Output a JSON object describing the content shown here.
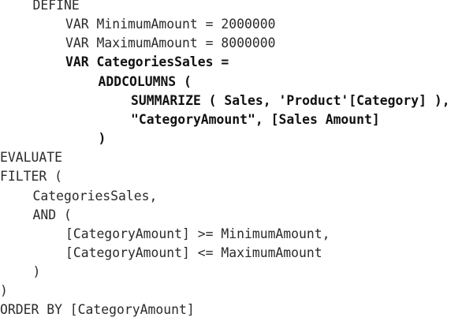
{
  "code": {
    "lines": [
      {
        "indent": 1,
        "text": "DEFINE",
        "bold": false
      },
      {
        "indent": 2,
        "text": "VAR MinimumAmount = 2000000",
        "bold": false
      },
      {
        "indent": 2,
        "text": "VAR MaximumAmount = 8000000",
        "bold": false
      },
      {
        "indent": 2,
        "text": "VAR CategoriesSales =",
        "bold": true
      },
      {
        "indent": 3,
        "text": "ADDCOLUMNS (",
        "bold": true
      },
      {
        "indent": 4,
        "text": "SUMMARIZE ( Sales, 'Product'[Category] ),",
        "bold": true
      },
      {
        "indent": 4,
        "text": "\"CategoryAmount\", [Sales Amount]",
        "bold": true
      },
      {
        "indent": 3,
        "text": ")",
        "bold": true
      },
      {
        "indent": 0,
        "text": "EVALUATE",
        "bold": false
      },
      {
        "indent": 0,
        "text": "FILTER (",
        "bold": false
      },
      {
        "indent": 1,
        "text": "CategoriesSales,",
        "bold": false
      },
      {
        "indent": 1,
        "text": "AND (",
        "bold": false
      },
      {
        "indent": 2,
        "text": "[CategoryAmount] >= MinimumAmount,",
        "bold": false
      },
      {
        "indent": 2,
        "text": "[CategoryAmount] <= MaximumAmount",
        "bold": false
      },
      {
        "indent": 1,
        "text": ")",
        "bold": false
      },
      {
        "indent": 0,
        "text": ")",
        "bold": false
      },
      {
        "indent": 0,
        "text": "ORDER BY [CategoryAmount]",
        "bold": false
      }
    ]
  }
}
